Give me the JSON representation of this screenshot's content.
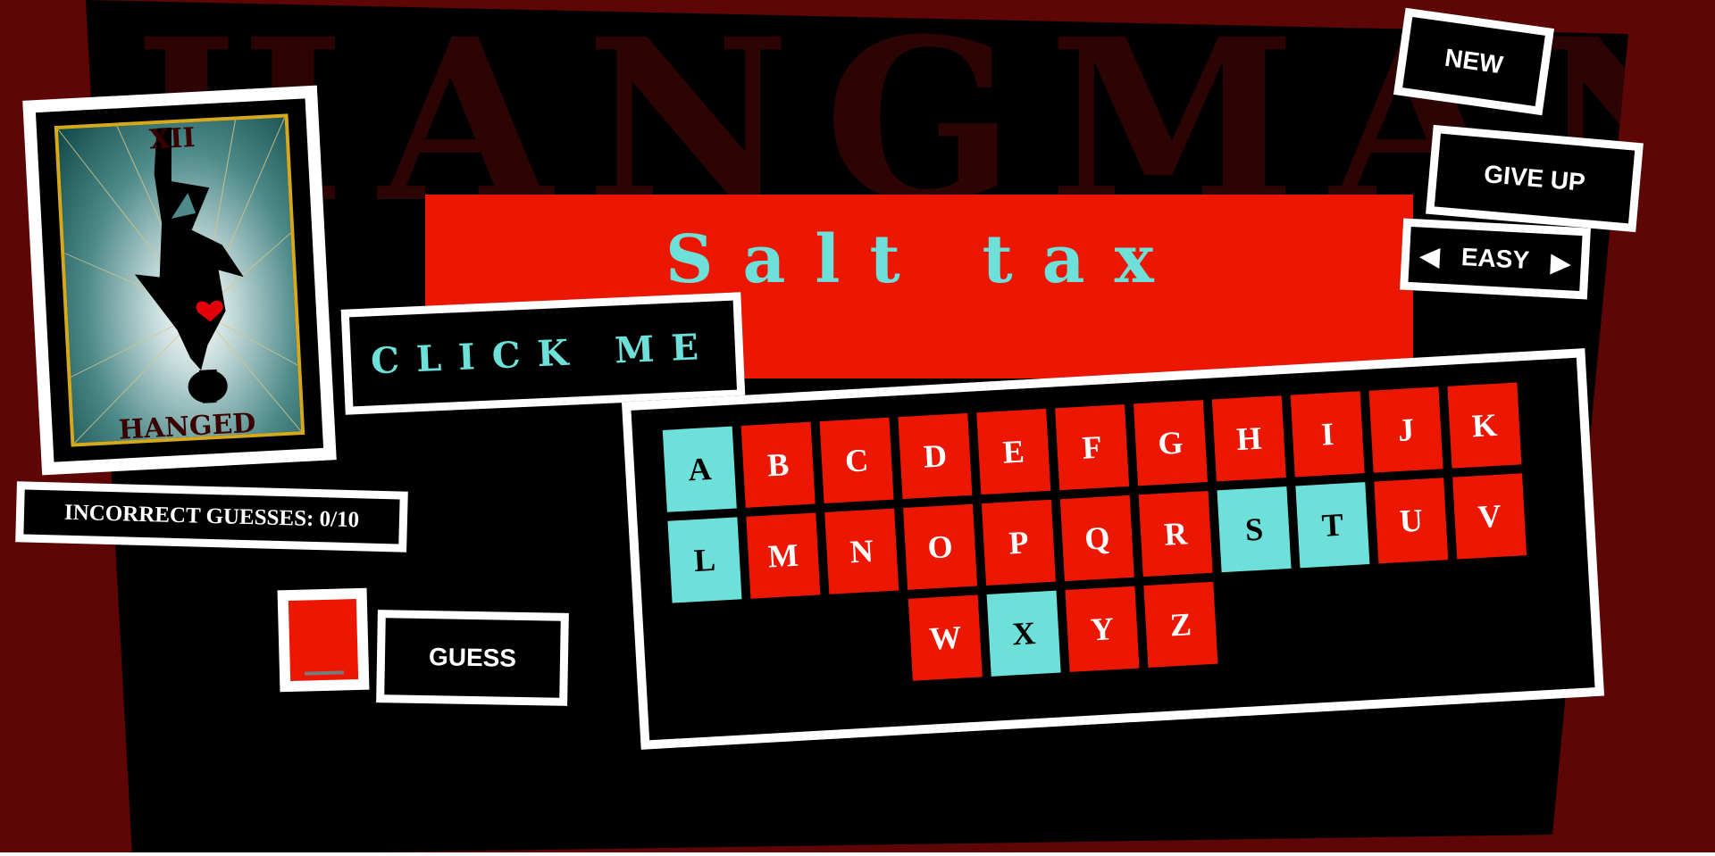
{
  "app": {
    "background_title": "HANGMAN"
  },
  "phrase": {
    "text": "Salt tax"
  },
  "click_me": {
    "label": "CLICK ME"
  },
  "tarot": {
    "numeral": "XII",
    "name": "HANGED"
  },
  "status": {
    "incorrect_label": "INCORRECT GUESSES: 0/10",
    "incorrect_count": 0,
    "incorrect_max": 10
  },
  "guess": {
    "input_value": "",
    "button_label": "GUESS"
  },
  "controls": {
    "new_label": "NEW",
    "give_up_label": "GIVE UP",
    "difficulty": "EASY",
    "prev_icon": "triangle-left-icon",
    "next_icon": "triangle-right-icon"
  },
  "keyboard": {
    "rows": [
      [
        {
          "letter": "A",
          "used": true
        },
        {
          "letter": "B",
          "used": false
        },
        {
          "letter": "C",
          "used": false
        },
        {
          "letter": "D",
          "used": false
        },
        {
          "letter": "E",
          "used": false
        },
        {
          "letter": "F",
          "used": false
        },
        {
          "letter": "G",
          "used": false
        },
        {
          "letter": "H",
          "used": false
        },
        {
          "letter": "I",
          "used": false
        },
        {
          "letter": "J",
          "used": false
        },
        {
          "letter": "K",
          "used": false
        }
      ],
      [
        {
          "letter": "L",
          "used": true
        },
        {
          "letter": "M",
          "used": false
        },
        {
          "letter": "N",
          "used": false
        },
        {
          "letter": "O",
          "used": false
        },
        {
          "letter": "P",
          "used": false
        },
        {
          "letter": "Q",
          "used": false
        },
        {
          "letter": "R",
          "used": false
        },
        {
          "letter": "S",
          "used": true
        },
        {
          "letter": "T",
          "used": true
        },
        {
          "letter": "U",
          "used": false
        },
        {
          "letter": "V",
          "used": false
        }
      ],
      [
        {
          "letter": "W",
          "used": false
        },
        {
          "letter": "X",
          "used": true
        },
        {
          "letter": "Y",
          "used": false
        },
        {
          "letter": "Z",
          "used": false
        }
      ]
    ]
  },
  "colors": {
    "page_bg": "#5e0606",
    "banner_red": "#ec1703",
    "accent_cyan": "#6de1d9",
    "panel_black": "#000000",
    "frame_white": "#ffffff",
    "card_gold": "#d4a91e"
  }
}
